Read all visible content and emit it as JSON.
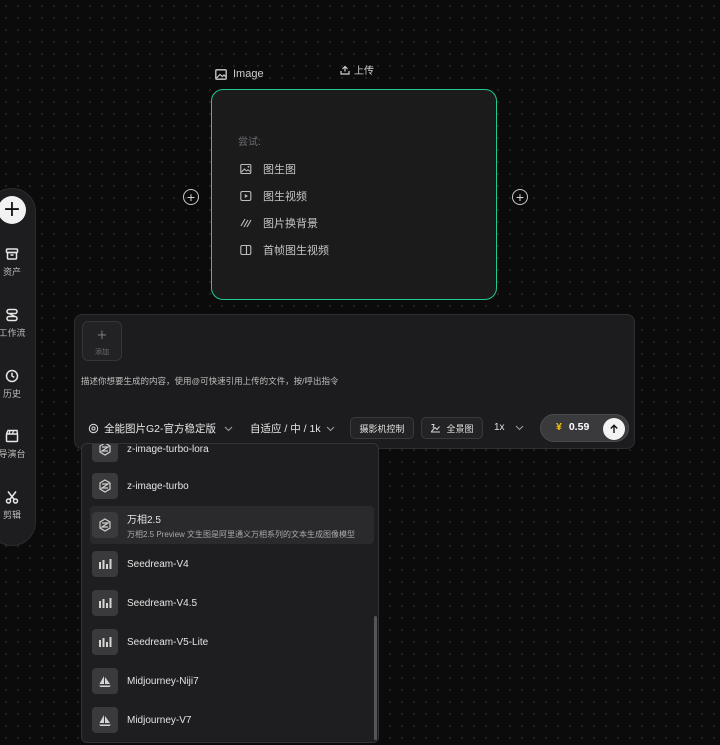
{
  "sidebar": {
    "items": [
      {
        "label": "资产",
        "icon": "archive-icon"
      },
      {
        "label": "工作流",
        "icon": "workflow-icon"
      },
      {
        "label": "历史",
        "icon": "clock-icon"
      },
      {
        "label": "导演台",
        "icon": "clapperboard-icon"
      },
      {
        "label": "剪辑",
        "icon": "scissors-icon"
      }
    ]
  },
  "node": {
    "label": "Image",
    "upload": "上传",
    "try_label": "尝试:",
    "suggestions": [
      {
        "label": "图生图",
        "icon": "image-edit-icon"
      },
      {
        "label": "图生视频",
        "icon": "video-play-icon"
      },
      {
        "label": "图片换背景",
        "icon": "hatch-icon"
      },
      {
        "label": "首帧图生视频",
        "icon": "frame-icon"
      }
    ]
  },
  "prompt": {
    "attach_label": "添加",
    "placeholder": "描述你想要生成的内容，使用@可快速引用上传的文件，按/呼出指令",
    "model": "全能图片G2-官方稳定版",
    "ratio": "自适应 / 中 / 1k",
    "camera_button": "摄影机控制",
    "panorama_button": "全景图",
    "count": "1x",
    "currency": "¥",
    "price": "0.59"
  },
  "dropdown": {
    "items": [
      {
        "name": "z-image-turbo-lora",
        "icon": "z-image-icon"
      },
      {
        "name": "z-image-turbo",
        "icon": "z-image-icon"
      },
      {
        "name": "万相2.5",
        "desc": "万相2.5 Preview 文生图是阿里通义万相系列的文本生成图像模型",
        "icon": "z-image-icon"
      },
      {
        "name": "Seedream-V4",
        "icon": "seedream-icon"
      },
      {
        "name": "Seedream-V4.5",
        "icon": "seedream-icon"
      },
      {
        "name": "Seedream-V5-Lite",
        "icon": "seedream-icon"
      },
      {
        "name": "Midjourney-Niji7",
        "icon": "sailboat-icon"
      },
      {
        "name": "Midjourney-V7",
        "icon": "sailboat-icon"
      }
    ]
  },
  "colors": {
    "accent": "#1fc98f",
    "price_symbol": "#f1c40f",
    "background": "#0b0b0c"
  }
}
